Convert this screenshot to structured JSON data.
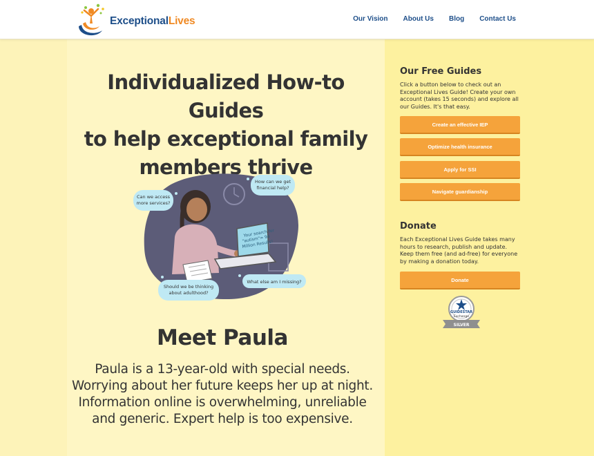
{
  "header": {
    "logo_word_1": "Exceptional",
    "logo_word_2": "Lives",
    "nav": [
      "Our Vision",
      "About Us",
      "Blog",
      "Contact Us"
    ]
  },
  "hero": {
    "title_lines": [
      "Individualized How-to Guides",
      "to help exceptional family",
      "members thrive"
    ]
  },
  "illustration": {
    "bubbles": [
      "Can we access more services?",
      "How can we get financial help?",
      "Should we be thinking about adulthood?",
      "What else am I missing?"
    ],
    "screen_text": "Your search for \"autism\"= 94 Million Results!"
  },
  "meet": {
    "heading": "Meet Paula",
    "description": "Paula is a 13-year-old with special needs. Worrying about her future keeps her up at night. Information online is overwhelming, unreliable and generic. Expert help is too expensive."
  },
  "sidebar": {
    "guides_heading": "Our Free Guides",
    "guides_text": "Click a button below to check out an Exceptional Lives Guide! Create your own account (takes 15 seconds) and explore all our Guides. It's that easy.",
    "guide_buttons": [
      "Create an effective IEP",
      "Optimize health insurance",
      "Apply for SSI",
      "Navigate guardianship"
    ],
    "donate_heading": "Donate",
    "donate_text": "Each Exceptional Lives Guide takes many hours to research, publish and update. Keep them free (and ad-free) for everyone by making a donation today.",
    "donate_button": "Donate",
    "seal": {
      "line1": "GUIDESTAR",
      "line2": "Exchange",
      "line3": "SILVER"
    }
  },
  "colors": {
    "accent_orange": "#f5a33b",
    "brand_blue": "#1d4e89",
    "main_bg": "#fef6c4",
    "sidebar_bg": "#fdf19f"
  }
}
